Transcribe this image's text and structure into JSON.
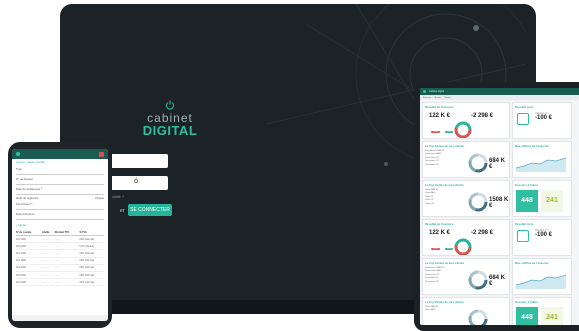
{
  "laptop": {
    "logo": {
      "line1": "cabinet",
      "line2": "DIGITAL"
    },
    "password_mask_icon": "eye-icon",
    "forgot_link": "oublié ?",
    "create_link": "er",
    "connect_button": "SE CONNECTER"
  },
  "phone": {
    "breadcrumb": "Accueil > Saisie nouvelle",
    "fields": [
      {
        "label": "Type"
      },
      {
        "label": "N° de dossier"
      },
      {
        "label": "Date de la dépense *"
      },
      {
        "label": "Mode de règlement",
        "value": "Chèque"
      },
      {
        "label": "Fournisseur *"
      },
      {
        "label": "Date échéance"
      }
    ],
    "add_link": "+ Ajouter",
    "table": {
      "headers": [
        "N° de compte",
        "Libellé",
        "Montant TTC",
        "% TVA"
      ],
      "rows": [
        [
          "401 0000",
          "...........",
          "........",
          "20% (Normal)"
        ],
        [
          "401 1000",
          "...........",
          "........",
          "5,5% (Réduit)"
        ],
        [
          "401 2000",
          "...........",
          "........",
          "20% (Normal)"
        ],
        [
          "401 3000",
          "...........",
          "........",
          "20% (Normal)"
        ],
        [
          "401 4000",
          "...........",
          "........",
          "20% (Normal)"
        ],
        [
          "401 5000",
          "...........",
          "........",
          "20% (Normal)"
        ],
        [
          "401 6000",
          "...........",
          "........",
          "20% (Normal)"
        ]
      ]
    }
  },
  "tablet": {
    "topbar_text": "Cabinet digital",
    "subbar": [
      "Factures",
      "Achats",
      "Ventes"
    ],
    "cards": [
      {
        "title": "Résultat de l'exercice",
        "kpi": "122 K €",
        "kpi2": "-2 298 €",
        "pill1": "-20%",
        "pill2": "+8%"
      },
      {
        "title": "Résultat mois",
        "kpi": "-100 €",
        "kpi_sub": "Variation N-1"
      },
      {
        "title": "Le Top Achats de mes clients",
        "list": [
          "Fournisseur MEF31",
          "Fournisseur ABC",
          "Fournisseur 11",
          "Prestataire 22",
          "Prestataire 33"
        ],
        "total": "684 K €"
      },
      {
        "title": "Mes chiffres de l'exercice",
        "kpi": ""
      },
      {
        "title": "Le Top Ventes de mes clients",
        "list": [
          "Client MEF31",
          "Client ABC",
          "Client 11",
          "Client 22",
          "Client 33"
        ],
        "total": "1508 K €"
      },
      {
        "title": "Dossiers à traiter",
        "tile1": "448",
        "tile2": "241"
      },
      {
        "title": "Résultat de l'exercice",
        "kpi": "122 K €",
        "kpi2": "-2 298 €",
        "pill1": "-20%",
        "pill2": "+8%"
      },
      {
        "title": "Résultat mois",
        "kpi": "-100 €",
        "kpi_sub": "Variation N-1"
      },
      {
        "title": "Le Top Achats de mes clients",
        "list": [
          "Fournisseur MEF31",
          "Fournisseur ABC",
          "Fournisseur 11",
          "Prestataire 22",
          "Prestataire 33"
        ],
        "total": "684 K €"
      },
      {
        "title": "Mes chiffres de l'exercice",
        "kpi": ""
      },
      {
        "title": "Le Top Ventes de mes clients",
        "list": [
          "Client MEF31",
          "Client ABC"
        ],
        "total": ""
      },
      {
        "title": "Dossiers à traiter",
        "tile1": "448",
        "tile2": "241"
      }
    ]
  },
  "colors": {
    "accent": "#27b39a",
    "dark": "#1c2327",
    "red": "#d9534f"
  }
}
